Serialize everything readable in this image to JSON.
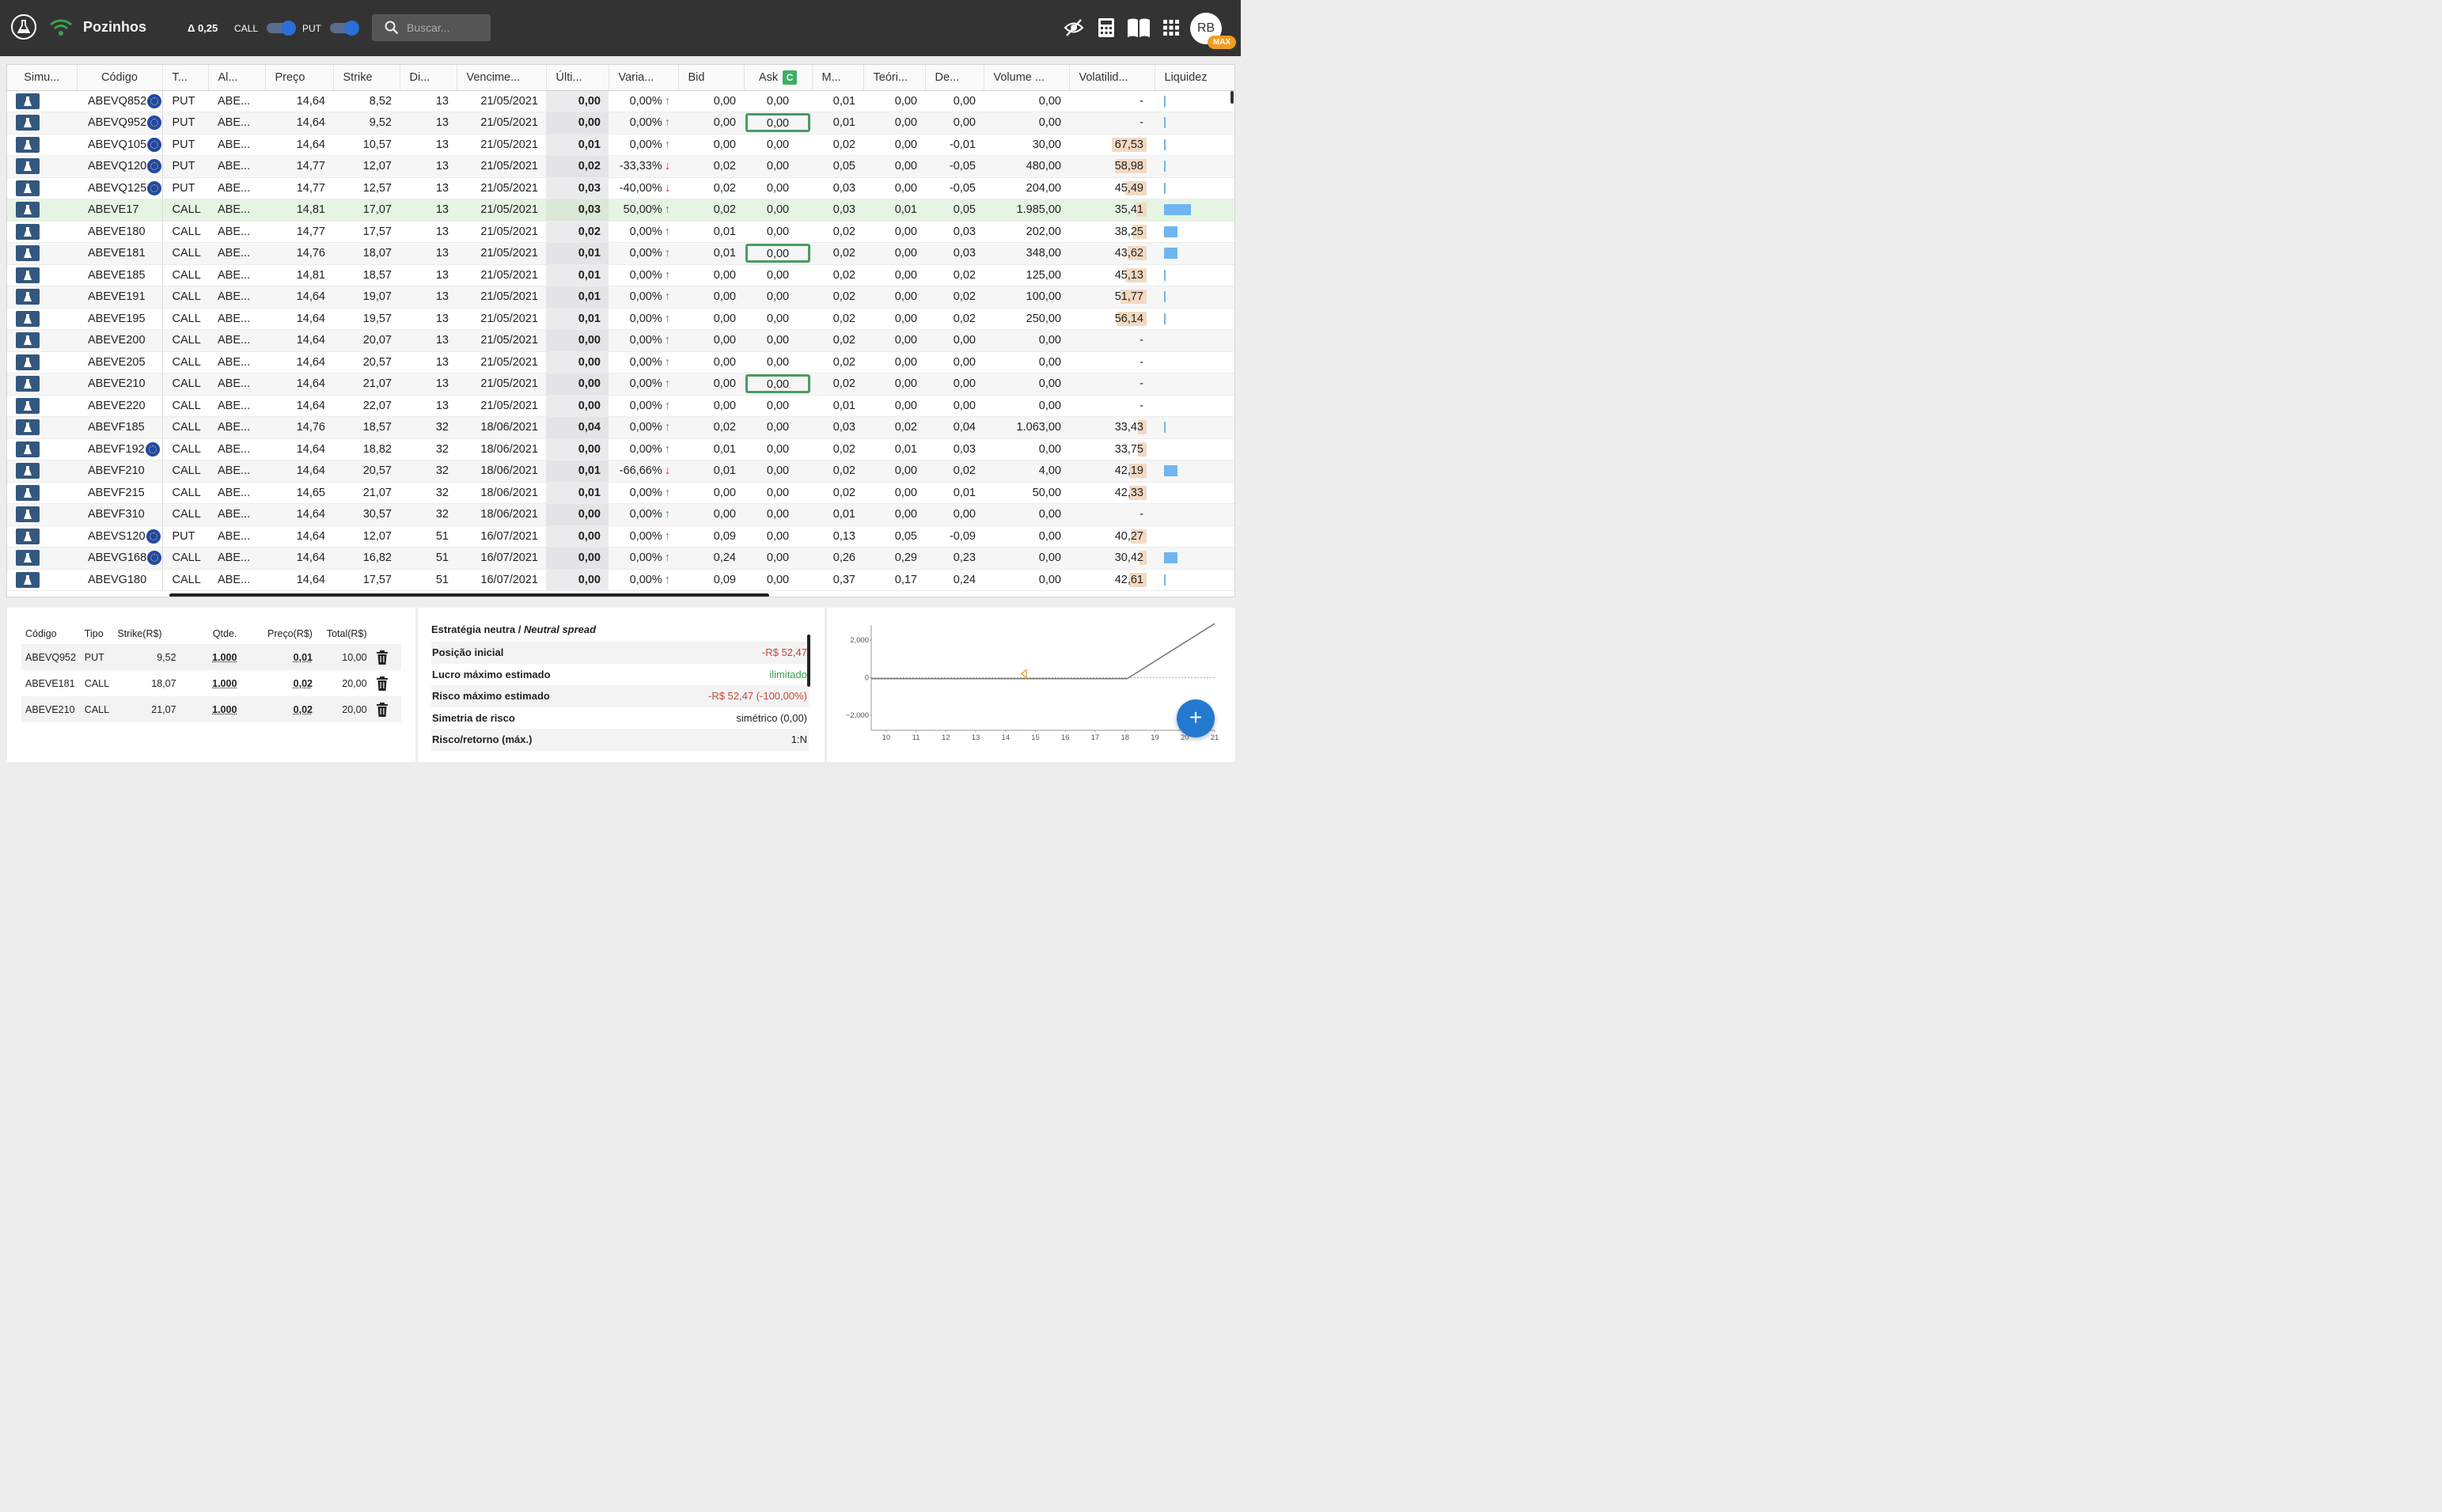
{
  "header": {
    "title": "Pozinhos",
    "delta": "Δ 0,25",
    "call_label": "CALL",
    "put_label": "PUT",
    "search_placeholder": "Buscar...",
    "avatar_initials": "RB",
    "plan_badge": "MAX"
  },
  "table": {
    "columns": [
      "Simu...",
      "Código",
      "T...",
      "Al...",
      "Preço",
      "Strike",
      "Di...",
      "Vencime...",
      "Últi...",
      "Varia...",
      "Bid",
      "Ask",
      "M...",
      "Teóri...",
      "De...",
      "Volume ...",
      "Volatilid...",
      "Liquidez"
    ],
    "ask_badge": "C",
    "rows": [
      {
        "code": "ABEVQ852",
        "eu": true,
        "type": "PUT",
        "al": "ABE...",
        "price": "14,64",
        "strike": "8,52",
        "days": "13",
        "exp": "21/05/2021",
        "last": "0,00",
        "var": "0,00%",
        "dir": "up",
        "bid": "0,00",
        "ask": "0,00",
        "ask_sel": false,
        "m": "0,01",
        "teo": "0,00",
        "de": "0,00",
        "vol": "0,00",
        "iv": "-",
        "iv_level": 0,
        "liq": 0
      },
      {
        "code": "ABEVQ952",
        "eu": true,
        "type": "PUT",
        "al": "ABE...",
        "price": "14,64",
        "strike": "9,52",
        "days": "13",
        "exp": "21/05/2021",
        "last": "0,00",
        "var": "0,00%",
        "dir": "up",
        "bid": "0,00",
        "ask": "0,00",
        "ask_sel": true,
        "m": "0,01",
        "teo": "0,00",
        "de": "0,00",
        "vol": "0,00",
        "iv": "-",
        "iv_level": 0,
        "liq": 0
      },
      {
        "code": "ABEVQ105",
        "eu": true,
        "type": "PUT",
        "al": "ABE...",
        "price": "14,64",
        "strike": "10,57",
        "days": "13",
        "exp": "21/05/2021",
        "last": "0,01",
        "var": "0,00%",
        "dir": "up",
        "bid": "0,00",
        "ask": "0,00",
        "ask_sel": false,
        "m": "0,02",
        "teo": "0,00",
        "de": "-0,01",
        "vol": "30,00",
        "iv": "67,53",
        "iv_level": 1.0,
        "liq": 0
      },
      {
        "code": "ABEVQ120",
        "eu": true,
        "type": "PUT",
        "al": "ABE...",
        "price": "14,77",
        "strike": "12,07",
        "days": "13",
        "exp": "21/05/2021",
        "last": "0,02",
        "var": "-33,33%",
        "dir": "down",
        "bid": "0,02",
        "ask": "0,00",
        "ask_sel": false,
        "m": "0,05",
        "teo": "0,00",
        "de": "-0,05",
        "vol": "480,00",
        "iv": "58,98",
        "iv_level": 0.9,
        "liq": 0
      },
      {
        "code": "ABEVQ125",
        "eu": true,
        "type": "PUT",
        "al": "ABE...",
        "price": "14,77",
        "strike": "12,57",
        "days": "13",
        "exp": "21/05/2021",
        "last": "0,03",
        "var": "-40,00%",
        "dir": "down",
        "bid": "0,02",
        "ask": "0,00",
        "ask_sel": false,
        "m": "0,03",
        "teo": "0,00",
        "de": "-0,05",
        "vol": "204,00",
        "iv": "45,49",
        "iv_level": 0.6,
        "liq": 0
      },
      {
        "code": "ABEVE17",
        "eu": false,
        "type": "CALL",
        "al": "ABE...",
        "price": "14,81",
        "strike": "17,07",
        "days": "13",
        "exp": "21/05/2021",
        "last": "0,03",
        "var": "50,00%",
        "dir": "up",
        "bid": "0,02",
        "ask": "0,00",
        "ask_sel": false,
        "m": "0,03",
        "teo": "0,01",
        "de": "0,05",
        "vol": "1.985,00",
        "iv": "35,41",
        "iv_level": 0.3,
        "liq": 1.0,
        "highlight": true
      },
      {
        "code": "ABEVE180",
        "eu": false,
        "type": "CALL",
        "al": "ABE...",
        "price": "14,77",
        "strike": "17,57",
        "days": "13",
        "exp": "21/05/2021",
        "last": "0,02",
        "var": "0,00%",
        "dir": "up",
        "bid": "0,01",
        "ask": "0,00",
        "ask_sel": false,
        "m": "0,02",
        "teo": "0,00",
        "de": "0,03",
        "vol": "202,00",
        "iv": "38,25",
        "iv_level": 0.4,
        "liq": 0.5
      },
      {
        "code": "ABEVE181",
        "eu": false,
        "type": "CALL",
        "al": "ABE...",
        "price": "14,76",
        "strike": "18,07",
        "days": "13",
        "exp": "21/05/2021",
        "last": "0,01",
        "var": "0,00%",
        "dir": "up",
        "bid": "0,01",
        "ask": "0,00",
        "ask_sel": true,
        "m": "0,02",
        "teo": "0,00",
        "de": "0,03",
        "vol": "348,00",
        "iv": "43,62",
        "iv_level": 0.55,
        "liq": 0.5
      },
      {
        "code": "ABEVE185",
        "eu": false,
        "type": "CALL",
        "al": "ABE...",
        "price": "14,81",
        "strike": "18,57",
        "days": "13",
        "exp": "21/05/2021",
        "last": "0,01",
        "var": "0,00%",
        "dir": "up",
        "bid": "0,00",
        "ask": "0,00",
        "ask_sel": false,
        "m": "0,02",
        "teo": "0,00",
        "de": "0,02",
        "vol": "125,00",
        "iv": "45,13",
        "iv_level": 0.6,
        "liq": 0
      },
      {
        "code": "ABEVE191",
        "eu": false,
        "type": "CALL",
        "al": "ABE...",
        "price": "14,64",
        "strike": "19,07",
        "days": "13",
        "exp": "21/05/2021",
        "last": "0,01",
        "var": "0,00%",
        "dir": "up",
        "bid": "0,00",
        "ask": "0,00",
        "ask_sel": false,
        "m": "0,02",
        "teo": "0,00",
        "de": "0,02",
        "vol": "100,00",
        "iv": "51,77",
        "iv_level": 0.75,
        "liq": 0
      },
      {
        "code": "ABEVE195",
        "eu": false,
        "type": "CALL",
        "al": "ABE...",
        "price": "14,64",
        "strike": "19,57",
        "days": "13",
        "exp": "21/05/2021",
        "last": "0,01",
        "var": "0,00%",
        "dir": "up",
        "bid": "0,00",
        "ask": "0,00",
        "ask_sel": false,
        "m": "0,02",
        "teo": "0,00",
        "de": "0,02",
        "vol": "250,00",
        "iv": "56,14",
        "iv_level": 0.85,
        "liq": 0
      },
      {
        "code": "ABEVE200",
        "eu": false,
        "type": "CALL",
        "al": "ABE...",
        "price": "14,64",
        "strike": "20,07",
        "days": "13",
        "exp": "21/05/2021",
        "last": "0,00",
        "var": "0,00%",
        "dir": "up",
        "bid": "0,00",
        "ask": "0,00",
        "ask_sel": false,
        "m": "0,02",
        "teo": "0,00",
        "de": "0,00",
        "vol": "0,00",
        "iv": "-",
        "iv_level": 0,
        "liq": -1
      },
      {
        "code": "ABEVE205",
        "eu": false,
        "type": "CALL",
        "al": "ABE...",
        "price": "14,64",
        "strike": "20,57",
        "days": "13",
        "exp": "21/05/2021",
        "last": "0,00",
        "var": "0,00%",
        "dir": "up",
        "bid": "0,00",
        "ask": "0,00",
        "ask_sel": false,
        "m": "0,02",
        "teo": "0,00",
        "de": "0,00",
        "vol": "0,00",
        "iv": "-",
        "iv_level": 0,
        "liq": -1
      },
      {
        "code": "ABEVE210",
        "eu": false,
        "type": "CALL",
        "al": "ABE...",
        "price": "14,64",
        "strike": "21,07",
        "days": "13",
        "exp": "21/05/2021",
        "last": "0,00",
        "var": "0,00%",
        "dir": "up",
        "bid": "0,00",
        "ask": "0,00",
        "ask_sel": true,
        "m": "0,02",
        "teo": "0,00",
        "de": "0,00",
        "vol": "0,00",
        "iv": "-",
        "iv_level": 0,
        "liq": -1
      },
      {
        "code": "ABEVE220",
        "eu": false,
        "type": "CALL",
        "al": "ABE...",
        "price": "14,64",
        "strike": "22,07",
        "days": "13",
        "exp": "21/05/2021",
        "last": "0,00",
        "var": "0,00%",
        "dir": "up",
        "bid": "0,00",
        "ask": "0,00",
        "ask_sel": false,
        "m": "0,01",
        "teo": "0,00",
        "de": "0,00",
        "vol": "0,00",
        "iv": "-",
        "iv_level": 0,
        "liq": -1
      },
      {
        "code": "ABEVF185",
        "eu": false,
        "type": "CALL",
        "al": "ABE...",
        "price": "14,76",
        "strike": "18,57",
        "days": "32",
        "exp": "18/06/2021",
        "last": "0,04",
        "var": "0,00%",
        "dir": "up",
        "bid": "0,02",
        "ask": "0,00",
        "ask_sel": false,
        "m": "0,03",
        "teo": "0,02",
        "de": "0,04",
        "vol": "1.063,00",
        "iv": "33,43",
        "iv_level": 0.25,
        "liq": 0
      },
      {
        "code": "ABEVF192",
        "eu": true,
        "type": "CALL",
        "al": "ABE...",
        "price": "14,64",
        "strike": "18,82",
        "days": "32",
        "exp": "18/06/2021",
        "last": "0,00",
        "var": "0,00%",
        "dir": "up",
        "bid": "0,01",
        "ask": "0,00",
        "ask_sel": false,
        "m": "0,02",
        "teo": "0,01",
        "de": "0,03",
        "vol": "0,00",
        "iv": "33,75",
        "iv_level": 0.25,
        "liq": -1
      },
      {
        "code": "ABEVF210",
        "eu": false,
        "type": "CALL",
        "al": "ABE...",
        "price": "14,64",
        "strike": "20,57",
        "days": "32",
        "exp": "18/06/2021",
        "last": "0,01",
        "var": "-66,66%",
        "dir": "down",
        "bid": "0,01",
        "ask": "0,00",
        "ask_sel": false,
        "m": "0,02",
        "teo": "0,00",
        "de": "0,02",
        "vol": "4,00",
        "iv": "42,19",
        "iv_level": 0.5,
        "liq": 0.5
      },
      {
        "code": "ABEVF215",
        "eu": false,
        "type": "CALL",
        "al": "ABE...",
        "price": "14,65",
        "strike": "21,07",
        "days": "32",
        "exp": "18/06/2021",
        "last": "0,01",
        "var": "0,00%",
        "dir": "up",
        "bid": "0,00",
        "ask": "0,00",
        "ask_sel": false,
        "m": "0,02",
        "teo": "0,00",
        "de": "0,01",
        "vol": "50,00",
        "iv": "42,33",
        "iv_level": 0.5,
        "liq": -1
      },
      {
        "code": "ABEVF310",
        "eu": false,
        "type": "CALL",
        "al": "ABE...",
        "price": "14,64",
        "strike": "30,57",
        "days": "32",
        "exp": "18/06/2021",
        "last": "0,00",
        "var": "0,00%",
        "dir": "up",
        "bid": "0,00",
        "ask": "0,00",
        "ask_sel": false,
        "m": "0,01",
        "teo": "0,00",
        "de": "0,00",
        "vol": "0,00",
        "iv": "-",
        "iv_level": 0,
        "liq": -1
      },
      {
        "code": "ABEVS120",
        "eu": true,
        "type": "PUT",
        "al": "ABE...",
        "price": "14,64",
        "strike": "12,07",
        "days": "51",
        "exp": "16/07/2021",
        "last": "0,00",
        "var": "0,00%",
        "dir": "up",
        "bid": "0,09",
        "ask": "0,00",
        "ask_sel": false,
        "m": "0,13",
        "teo": "0,05",
        "de": "-0,09",
        "vol": "0,00",
        "iv": "40,27",
        "iv_level": 0.45,
        "liq": -1
      },
      {
        "code": "ABEVG168",
        "eu": true,
        "type": "CALL",
        "al": "ABE...",
        "price": "14,64",
        "strike": "16,82",
        "days": "51",
        "exp": "16/07/2021",
        "last": "0,00",
        "var": "0,00%",
        "dir": "up",
        "bid": "0,24",
        "ask": "0,00",
        "ask_sel": false,
        "m": "0,26",
        "teo": "0,29",
        "de": "0,23",
        "vol": "0,00",
        "iv": "30,42",
        "iv_level": 0.2,
        "liq": 0.5
      },
      {
        "code": "ABEVG180",
        "eu": false,
        "type": "CALL",
        "al": "ABE...",
        "price": "14,64",
        "strike": "17,57",
        "days": "51",
        "exp": "16/07/2021",
        "last": "0,00",
        "var": "0,00%",
        "dir": "up",
        "bid": "0,09",
        "ask": "0,00",
        "ask_sel": false,
        "m": "0,37",
        "teo": "0,17",
        "de": "0,24",
        "vol": "0,00",
        "iv": "42,61",
        "iv_level": 0.5,
        "liq": 0
      }
    ]
  },
  "legs": {
    "columns": [
      "Código",
      "Tipo",
      "Strike(R$)",
      "Qtde.",
      "Preço(R$)",
      "Total(R$)"
    ],
    "rows": [
      {
        "code": "ABEVQ952",
        "type": "PUT",
        "strike": "9,52",
        "qty": "1.000",
        "price": "0,01",
        "total": "10,00"
      },
      {
        "code": "ABEVE181",
        "type": "CALL",
        "strike": "18,07",
        "qty": "1.000",
        "price": "0,02",
        "total": "20,00"
      },
      {
        "code": "ABEVE210",
        "type": "CALL",
        "strike": "21,07",
        "qty": "1.000",
        "price": "0,02",
        "total": "20,00"
      }
    ]
  },
  "strategy": {
    "title_pt": "Estratégia neutra / ",
    "title_en": "Neutral spread",
    "rows": [
      {
        "label": "Posição inicial",
        "value": "-R$ 52,47",
        "tone": "neg"
      },
      {
        "label": "Lucro máximo estimado",
        "value": "ilimitado",
        "tone": "pos"
      },
      {
        "label": "Risco máximo estimado",
        "value": "-R$ 52,47 (-100,00%)",
        "tone": "neg"
      },
      {
        "label": "Simetria de risco",
        "value": "simétrico (0,00)",
        "tone": ""
      },
      {
        "label": "Risco/retorno (máx.)",
        "value": "1:N",
        "tone": ""
      }
    ]
  },
  "chart_data": {
    "type": "line",
    "x_ticks": [
      10,
      11,
      12,
      13,
      14,
      15,
      16,
      17,
      18,
      19,
      20,
      21
    ],
    "y_ticks": [
      "2,000",
      "0",
      "−2,000"
    ],
    "y_tick_values": [
      2000,
      0,
      -2000
    ],
    "xlim": [
      9.5,
      21
    ],
    "ylim": [
      -2800,
      2800
    ],
    "series": [
      {
        "x": [
          9.5,
          18.07,
          21
        ],
        "y": [
          -52.47,
          -52.47,
          2877
        ]
      }
    ],
    "current_price": 14.64,
    "grid": false
  },
  "colors": {
    "topbar": "#333333",
    "sim_button": "#34577e",
    "accent_blue": "#2c6fd6",
    "ask_selected": "#4a9b64",
    "row_highlight": "#e6f4e3",
    "iv_bar": "#f2d9c2",
    "liquidity": "#6fb6f0",
    "max_badge": "#f29c1f",
    "payoff_line": "#777777",
    "marker": "#f0a020"
  }
}
